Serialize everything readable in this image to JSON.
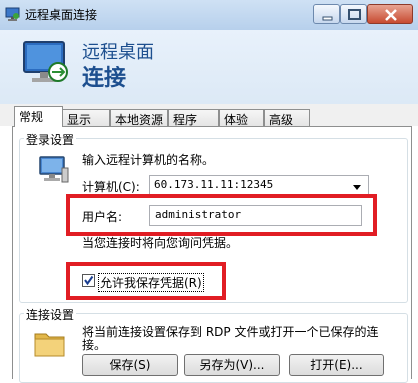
{
  "window": {
    "title": "远程桌面连接"
  },
  "header": {
    "title": "远程桌面",
    "subtitle": "连接"
  },
  "tabs": [
    {
      "label": "常规"
    },
    {
      "label": "显示"
    },
    {
      "label": "本地资源"
    },
    {
      "label": "程序"
    },
    {
      "label": "体验"
    },
    {
      "label": "高级"
    }
  ],
  "login": {
    "group_label": "登录设置",
    "prompt": "输入远程计算机的名称。",
    "computer_label": "计算机(C):",
    "computer_value": "60.173.11.11:12345",
    "user_label": "用户名:",
    "user_value": "administrator",
    "hint": "当您连接时将向您询问凭据。",
    "save_credentials_label": "允许我保存凭据(R)",
    "save_credentials_checked": true
  },
  "connection": {
    "group_label": "连接设置",
    "description_line1": "将当前连接设置保存到 RDP 文件或打开一个已保存的连",
    "description_line2": "接。",
    "save_button": "保存(S)",
    "save_as_button": "另存为(V)...",
    "open_button": "打开(E)..."
  },
  "colors": {
    "highlight_box": "#e11d24",
    "header_text": "#1d4f8f"
  },
  "icons": [
    "remote-desktop-app-icon",
    "minimize-icon",
    "maximize-icon",
    "close-icon",
    "remote-monitor-icon",
    "computer-icon",
    "dropdown-arrow-icon",
    "checkmark-icon",
    "folder-icon"
  ]
}
